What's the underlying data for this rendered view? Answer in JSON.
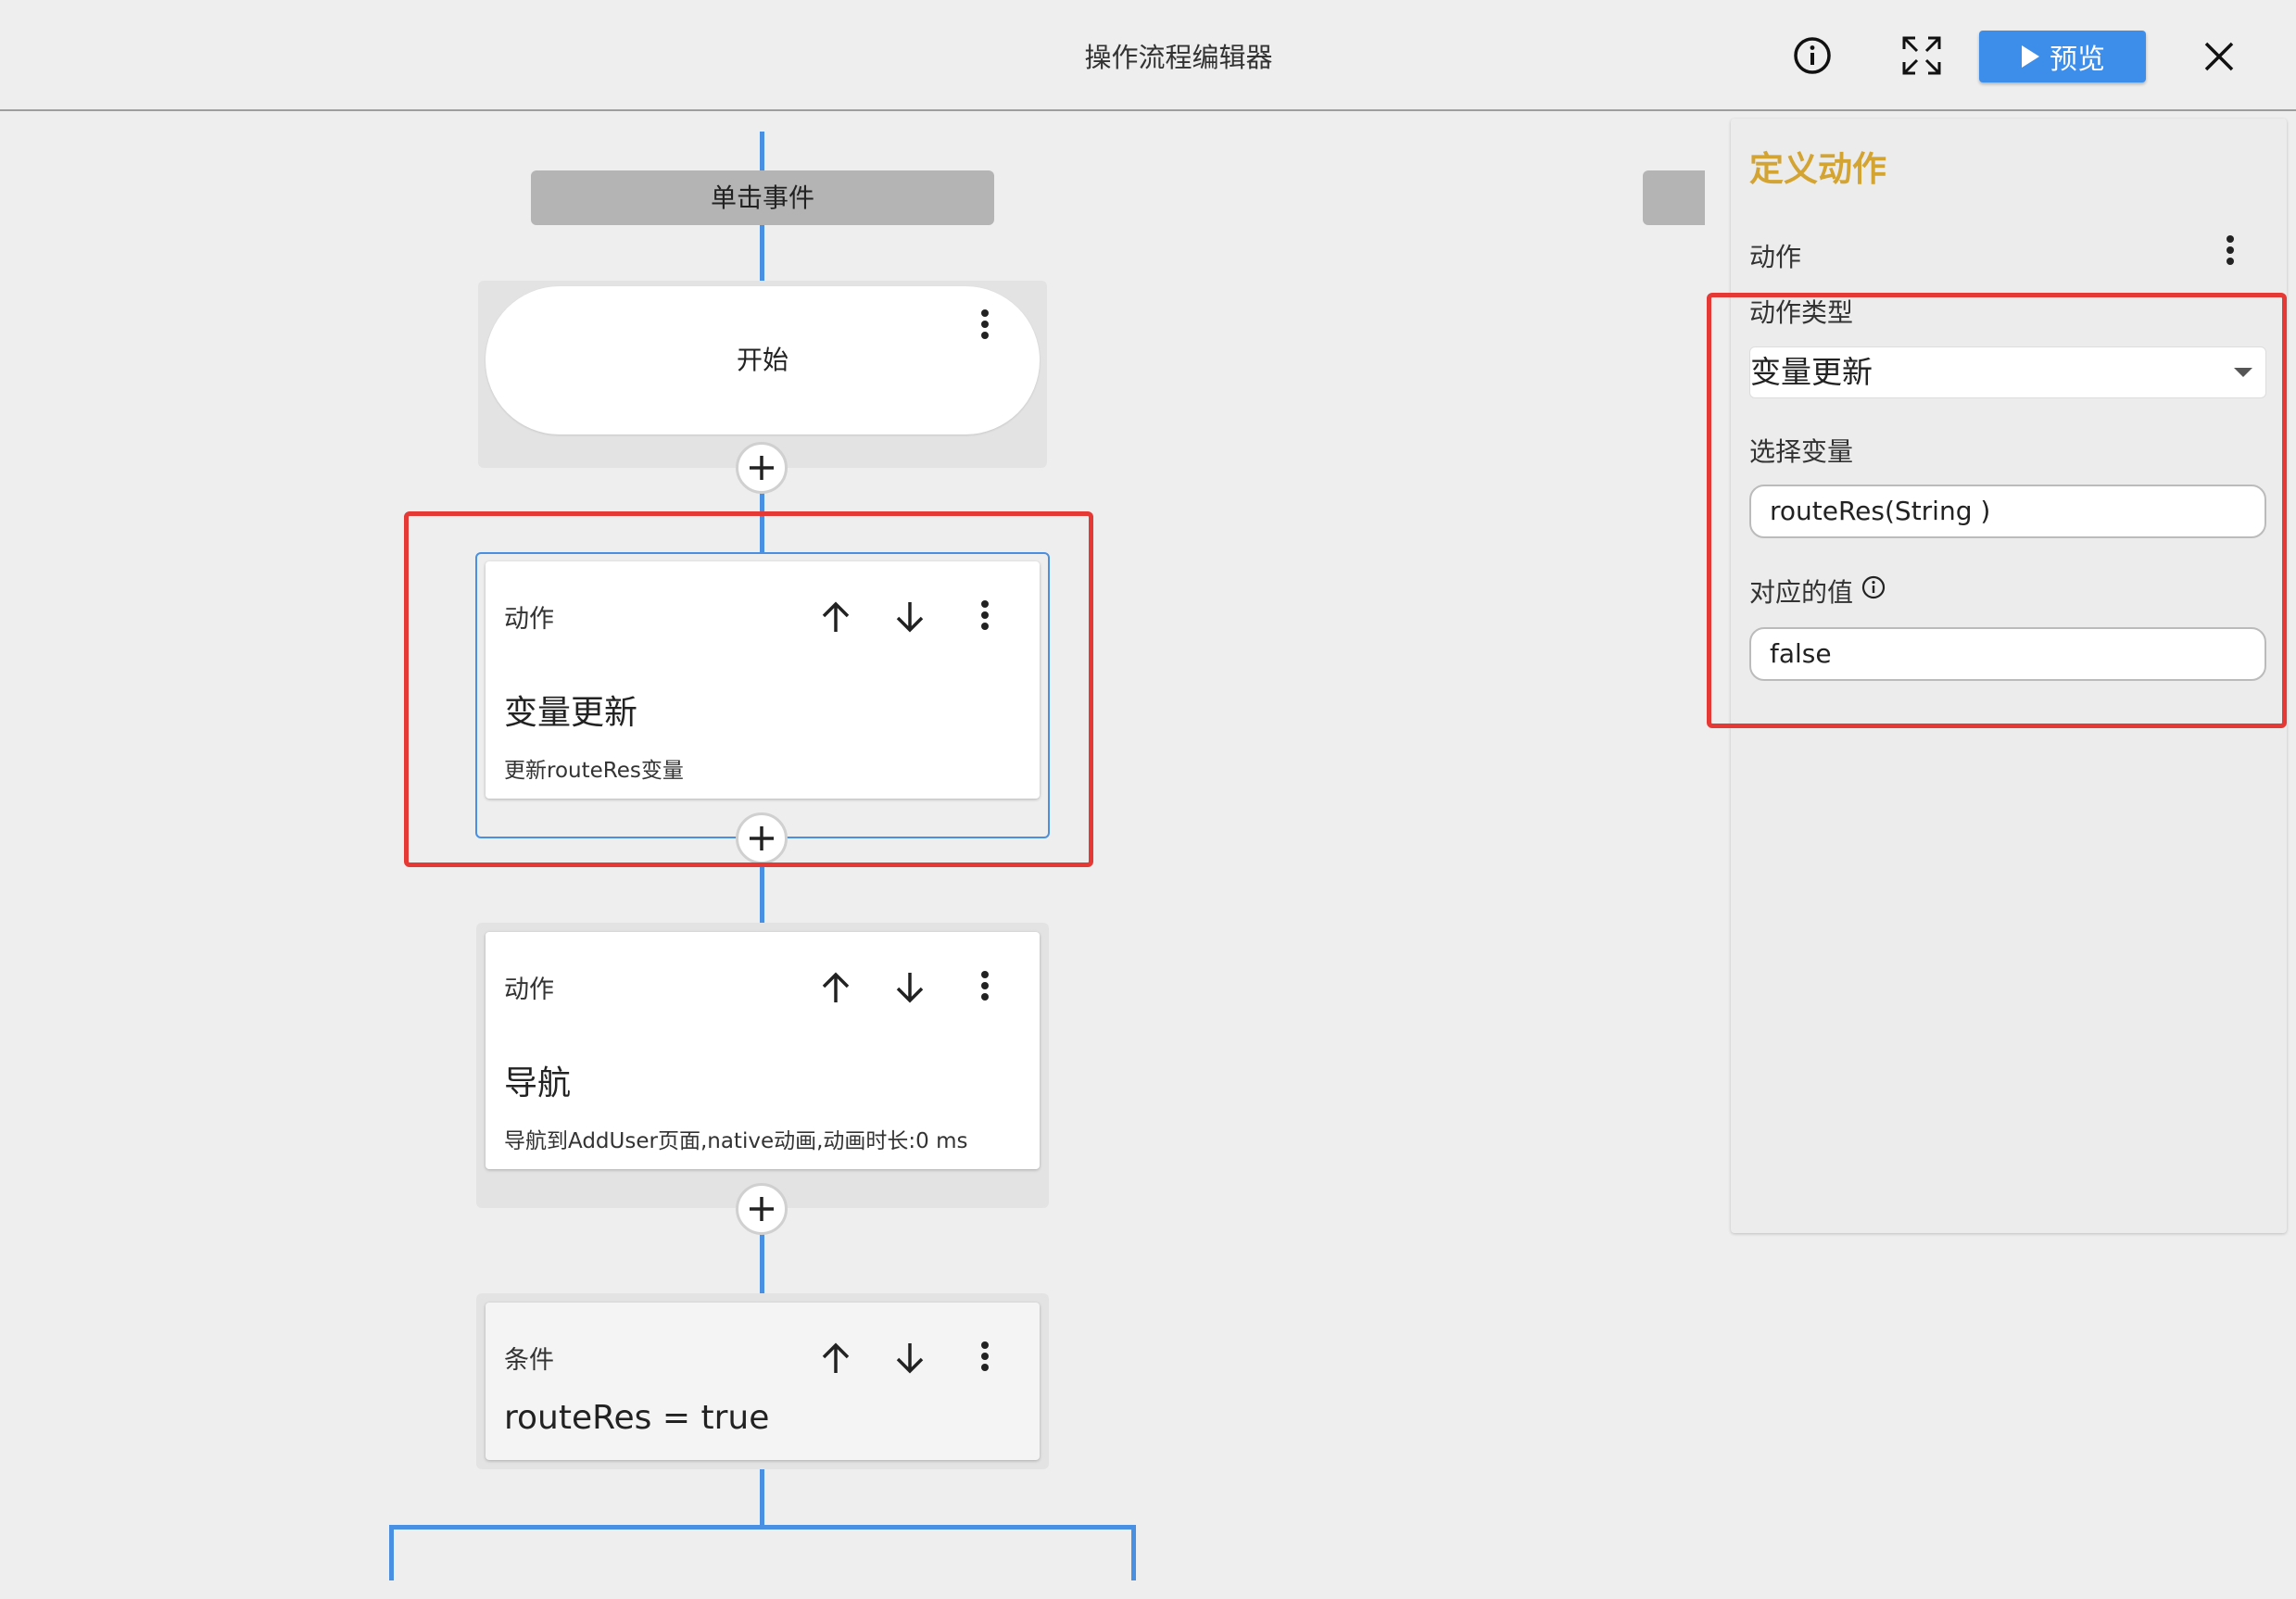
{
  "header": {
    "title": "操作流程编辑器",
    "preview_label": "预览",
    "info_icon": "info-circle-icon",
    "fullscreen_icon": "expand-arrows-icon",
    "close_icon": "close-icon"
  },
  "flow": {
    "event_label": "单击事件",
    "start_label": "开始",
    "nodes": [
      {
        "type": "动作",
        "name": "变量更新",
        "desc": "更新routeRes变量"
      },
      {
        "type": "动作",
        "name": "导航",
        "desc": "导航到AddUser页面,native动画,动画时长:0 ms"
      },
      {
        "type": "条件",
        "name": "routeRes = true"
      }
    ]
  },
  "panel": {
    "title": "定义动作",
    "section_label": "动作",
    "action_type_label": "动作类型",
    "action_type_value": "变量更新",
    "variable_label": "选择变量",
    "variable_value": "routeRes(String )",
    "value_label": "对应的值",
    "value_value": "false"
  },
  "colors": {
    "accent": "#3d8eea",
    "flow_line": "#4a90e2",
    "highlight": "#e53935",
    "panel_title": "#d4a432"
  }
}
